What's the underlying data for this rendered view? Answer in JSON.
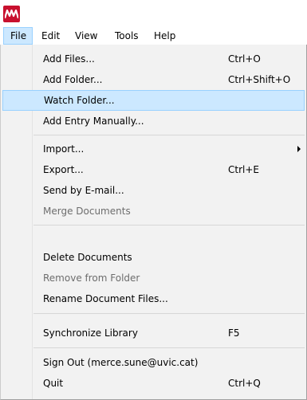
{
  "menubar": {
    "items": [
      "File",
      "Edit",
      "View",
      "Tools",
      "Help"
    ]
  },
  "file_menu": {
    "add_files": {
      "label": "Add Files...",
      "shortcut": "Ctrl+O"
    },
    "add_folder": {
      "label": "Add Folder...",
      "shortcut": "Ctrl+Shift+O"
    },
    "watch_folder": {
      "label": "Watch Folder..."
    },
    "add_entry": {
      "label": "Add Entry Manually..."
    },
    "import": {
      "label": "Import..."
    },
    "export": {
      "label": "Export...",
      "shortcut": "Ctrl+E"
    },
    "send_email": {
      "label": "Send by E-mail..."
    },
    "merge": {
      "label": "Merge Documents"
    },
    "delete": {
      "label": "Delete Documents"
    },
    "remove_folder": {
      "label": "Remove from Folder"
    },
    "rename": {
      "label": "Rename Document Files..."
    },
    "sync": {
      "label": "Synchronize Library",
      "shortcut": "F5"
    },
    "sign_out": {
      "label": "Sign Out (merce.sune@uvic.cat)"
    },
    "quit": {
      "label": "Quit",
      "shortcut": "Ctrl+Q"
    }
  }
}
